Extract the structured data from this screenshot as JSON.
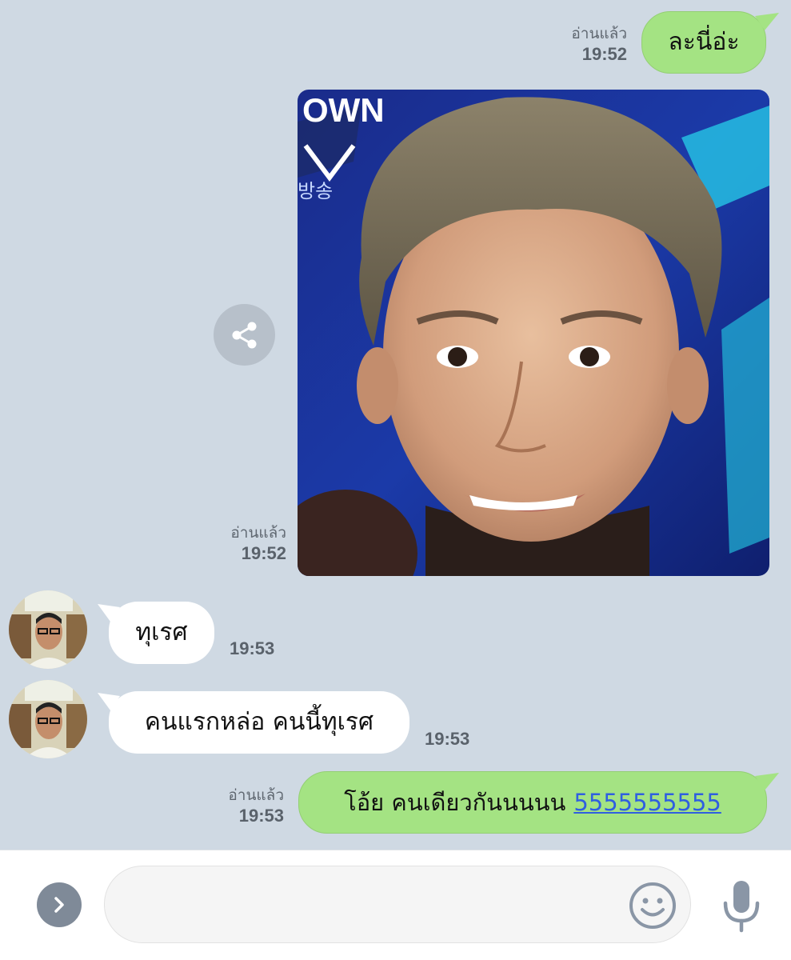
{
  "messages": [
    {
      "id": "m1",
      "direction": "outgoing",
      "type": "text",
      "text": "ละนี่อ่ะ",
      "read": "อ่านแล้ว",
      "time": "19:52"
    },
    {
      "id": "m2",
      "direction": "outgoing",
      "type": "image",
      "read": "อ่านแล้ว",
      "time": "19:52"
    },
    {
      "id": "m3",
      "direction": "incoming",
      "type": "text",
      "text": "ทุเรศ",
      "time": "19:53"
    },
    {
      "id": "m4",
      "direction": "incoming",
      "type": "text",
      "text": "คนแรกหล่อ คนนี้ทุเรศ",
      "time": "19:53"
    },
    {
      "id": "m5",
      "direction": "outgoing",
      "type": "text",
      "text": "โอ้ย คนเดียวกันนนนน",
      "link": "5555555555",
      "read": "อ่านแล้ว",
      "time": "19:53"
    }
  ],
  "image_overlay_text": {
    "show_name": "OWN",
    "korean": "방송"
  },
  "colors": {
    "background": "#cfd9e3",
    "outgoing_bubble": "#a4e383",
    "incoming_bubble": "#ffffff",
    "link": "#2f5fe0",
    "meta_text": "#5a626b"
  },
  "icons": {
    "share": "share-icon",
    "expand": "chevron-right-icon",
    "emoji": "smiley-icon",
    "mic": "microphone-icon"
  },
  "composer": {
    "placeholder": ""
  }
}
